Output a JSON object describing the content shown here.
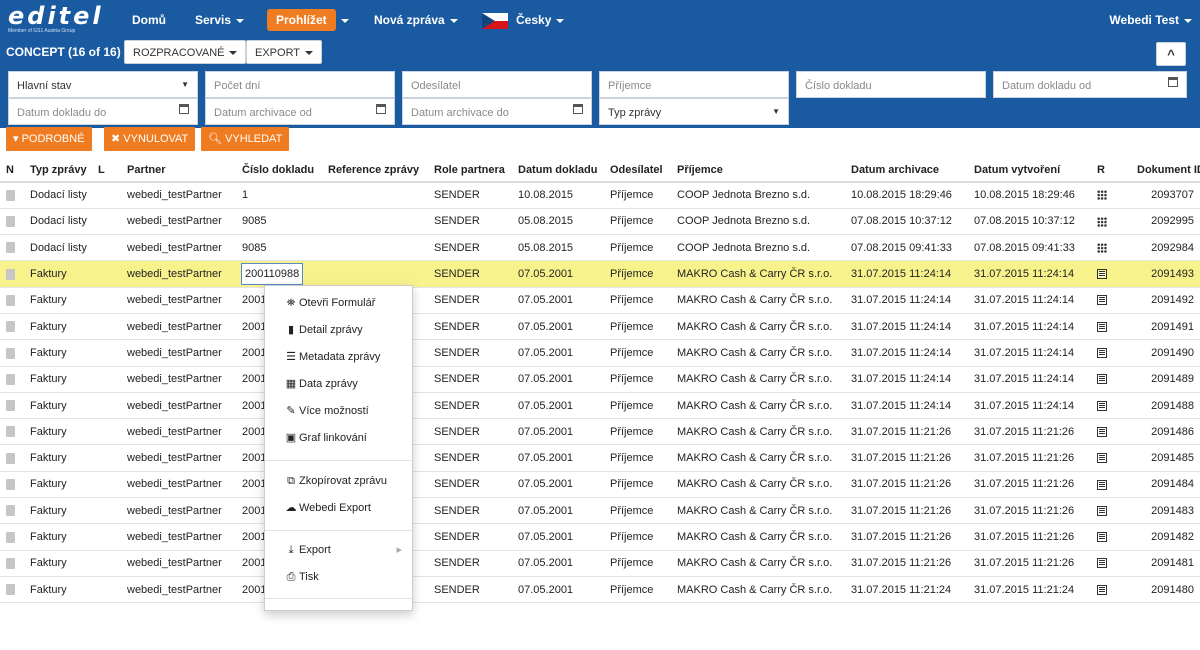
{
  "app": {
    "logo": "editel",
    "logo_tagline": "Member of GS1 Austria Group"
  },
  "nav": {
    "home": "Domů",
    "servis": "Servis",
    "prohlizet": "Prohlížet",
    "nova_zprava": "Nová zpráva",
    "language": "Česky",
    "user": "Webedi Test"
  },
  "toolbar": {
    "concept": "CONCEPT (16 of 16)",
    "rozpracovane": "ROZPRACOVANÉ",
    "export": "EXPORT",
    "collapse": "^"
  },
  "filters": {
    "hlavni_stav": "Hlavní stav",
    "pocet_dni": "Počet dní",
    "odesilatel": "Odesílatel",
    "prijemce": "Příjemce",
    "cislo_dokladu": "Číslo dokladu",
    "datum_dokladu_od": "Datum dokladu od",
    "datum_dokladu_do": "Datum dokladu do",
    "datum_archivace_od": "Datum archivace od",
    "datum_archivace_do": "Datum archivace do",
    "typ_zpravy": "Typ zprávy"
  },
  "buttons": {
    "podrobne": "PODROBNÉ",
    "vynulovat": "VYNULOVAT",
    "vyhledat": "VYHLEDAT"
  },
  "table": {
    "headers": [
      "N",
      "Typ zprávy",
      "L",
      "Partner",
      "Číslo dokladu",
      "Reference zprávy",
      "Role partnera",
      "Datum dokladu",
      "Odesílatel",
      "Příjemce",
      "Datum archivace",
      "Datum vytvoření",
      "R",
      "Dokument ID"
    ],
    "rows": [
      {
        "typ": "Dodací listy",
        "partner": "webedi_testPartner",
        "cislo": "1",
        "role": "SENDER",
        "datum": "10.08.2015",
        "odesilatel": "Příjemce",
        "prijemce": "COOP Jednota Brezno s.d.",
        "archivace": "10.08.2015 18:29:46",
        "vytvoreni": "10.08.2015 18:29:46",
        "r": "grid",
        "id": "2093707"
      },
      {
        "typ": "Dodací listy",
        "partner": "webedi_testPartner",
        "cislo": "9085",
        "role": "SENDER",
        "datum": "05.08.2015",
        "odesilatel": "Příjemce",
        "prijemce": "COOP Jednota Brezno s.d.",
        "archivace": "07.08.2015 10:37:12",
        "vytvoreni": "07.08.2015 10:37:12",
        "r": "grid",
        "id": "2092995"
      },
      {
        "typ": "Dodací listy",
        "partner": "webedi_testPartner",
        "cislo": "9085",
        "role": "SENDER",
        "datum": "05.08.2015",
        "odesilatel": "Příjemce",
        "prijemce": "COOP Jednota Brezno s.d.",
        "archivace": "07.08.2015 09:41:33",
        "vytvoreni": "07.08.2015 09:41:33",
        "r": "grid",
        "id": "2092984"
      },
      {
        "typ": "Faktury",
        "partner": "webedi_testPartner",
        "cislo": "200110988",
        "role": "SENDER",
        "datum": "07.05.2001",
        "odesilatel": "Příjemce",
        "prijemce": "MAKRO Cash & Carry ČR s.r.o.",
        "archivace": "31.07.2015 11:24:14",
        "vytvoreni": "31.07.2015 11:24:14",
        "r": "list",
        "id": "2091493"
      },
      {
        "typ": "Faktury",
        "partner": "webedi_testPartner",
        "cislo": "2001",
        "role": "SENDER",
        "datum": "07.05.2001",
        "odesilatel": "Příjemce",
        "prijemce": "MAKRO Cash & Carry ČR s.r.o.",
        "archivace": "31.07.2015 11:24:14",
        "vytvoreni": "31.07.2015 11:24:14",
        "r": "list",
        "id": "2091492"
      },
      {
        "typ": "Faktury",
        "partner": "webedi_testPartner",
        "cislo": "2001",
        "role": "SENDER",
        "datum": "07.05.2001",
        "odesilatel": "Příjemce",
        "prijemce": "MAKRO Cash & Carry ČR s.r.o.",
        "archivace": "31.07.2015 11:24:14",
        "vytvoreni": "31.07.2015 11:24:14",
        "r": "list",
        "id": "2091491"
      },
      {
        "typ": "Faktury",
        "partner": "webedi_testPartner",
        "cislo": "2001",
        "role": "SENDER",
        "datum": "07.05.2001",
        "odesilatel": "Příjemce",
        "prijemce": "MAKRO Cash & Carry ČR s.r.o.",
        "archivace": "31.07.2015 11:24:14",
        "vytvoreni": "31.07.2015 11:24:14",
        "r": "list",
        "id": "2091490"
      },
      {
        "typ": "Faktury",
        "partner": "webedi_testPartner",
        "cislo": "2001",
        "role": "SENDER",
        "datum": "07.05.2001",
        "odesilatel": "Příjemce",
        "prijemce": "MAKRO Cash & Carry ČR s.r.o.",
        "archivace": "31.07.2015 11:24:14",
        "vytvoreni": "31.07.2015 11:24:14",
        "r": "list",
        "id": "2091489"
      },
      {
        "typ": "Faktury",
        "partner": "webedi_testPartner",
        "cislo": "2001",
        "role": "SENDER",
        "datum": "07.05.2001",
        "odesilatel": "Příjemce",
        "prijemce": "MAKRO Cash & Carry ČR s.r.o.",
        "archivace": "31.07.2015 11:24:14",
        "vytvoreni": "31.07.2015 11:24:14",
        "r": "list",
        "id": "2091488"
      },
      {
        "typ": "Faktury",
        "partner": "webedi_testPartner",
        "cislo": "2001",
        "role": "SENDER",
        "datum": "07.05.2001",
        "odesilatel": "Příjemce",
        "prijemce": "MAKRO Cash & Carry ČR s.r.o.",
        "archivace": "31.07.2015 11:21:26",
        "vytvoreni": "31.07.2015 11:21:26",
        "r": "list",
        "id": "2091486"
      },
      {
        "typ": "Faktury",
        "partner": "webedi_testPartner",
        "cislo": "2001",
        "role": "SENDER",
        "datum": "07.05.2001",
        "odesilatel": "Příjemce",
        "prijemce": "MAKRO Cash & Carry ČR s.r.o.",
        "archivace": "31.07.2015 11:21:26",
        "vytvoreni": "31.07.2015 11:21:26",
        "r": "list",
        "id": "2091485"
      },
      {
        "typ": "Faktury",
        "partner": "webedi_testPartner",
        "cislo": "2001",
        "role": "SENDER",
        "datum": "07.05.2001",
        "odesilatel": "Příjemce",
        "prijemce": "MAKRO Cash & Carry ČR s.r.o.",
        "archivace": "31.07.2015 11:21:26",
        "vytvoreni": "31.07.2015 11:21:26",
        "r": "list",
        "id": "2091484"
      },
      {
        "typ": "Faktury",
        "partner": "webedi_testPartner",
        "cislo": "2001",
        "role": "SENDER",
        "datum": "07.05.2001",
        "odesilatel": "Příjemce",
        "prijemce": "MAKRO Cash & Carry ČR s.r.o.",
        "archivace": "31.07.2015 11:21:26",
        "vytvoreni": "31.07.2015 11:21:26",
        "r": "list",
        "id": "2091483"
      },
      {
        "typ": "Faktury",
        "partner": "webedi_testPartner",
        "cislo": "2001",
        "role": "SENDER",
        "datum": "07.05.2001",
        "odesilatel": "Příjemce",
        "prijemce": "MAKRO Cash & Carry ČR s.r.o.",
        "archivace": "31.07.2015 11:21:26",
        "vytvoreni": "31.07.2015 11:21:26",
        "r": "list",
        "id": "2091482"
      },
      {
        "typ": "Faktury",
        "partner": "webedi_testPartner",
        "cislo": "2001",
        "role": "SENDER",
        "datum": "07.05.2001",
        "odesilatel": "Příjemce",
        "prijemce": "MAKRO Cash & Carry ČR s.r.o.",
        "archivace": "31.07.2015 11:21:26",
        "vytvoreni": "31.07.2015 11:21:26",
        "r": "list",
        "id": "2091481"
      },
      {
        "typ": "Faktury",
        "partner": "webedi_testPartner",
        "cislo": "2001",
        "role": "SENDER",
        "datum": "07.05.2001",
        "odesilatel": "Příjemce",
        "prijemce": "MAKRO Cash & Carry ČR s.r.o.",
        "archivace": "31.07.2015 11:21:24",
        "vytvoreni": "31.07.2015 11:21:24",
        "r": "list",
        "id": "2091480"
      }
    ],
    "highlighted_row": 3
  },
  "context_menu": {
    "oteviri_formular": "Otevři Formulář",
    "detail_zpravy": "Detail zprávy",
    "metadata_zpravy": "Metadata zprávy",
    "data_zpravy": "Data zprávy",
    "vice_moznosti": "Více možností",
    "graf_linkovani": "Graf linkování",
    "zkopirovat_zpravu": "Zkopírovat zprávu",
    "webedi_export": "Webedi Export",
    "export": "Export",
    "tisk": "Tisk"
  },
  "colors": {
    "header_bg": "#1a5aa0",
    "accent": "#f07c22",
    "highlight_row": "#f8f28c"
  }
}
